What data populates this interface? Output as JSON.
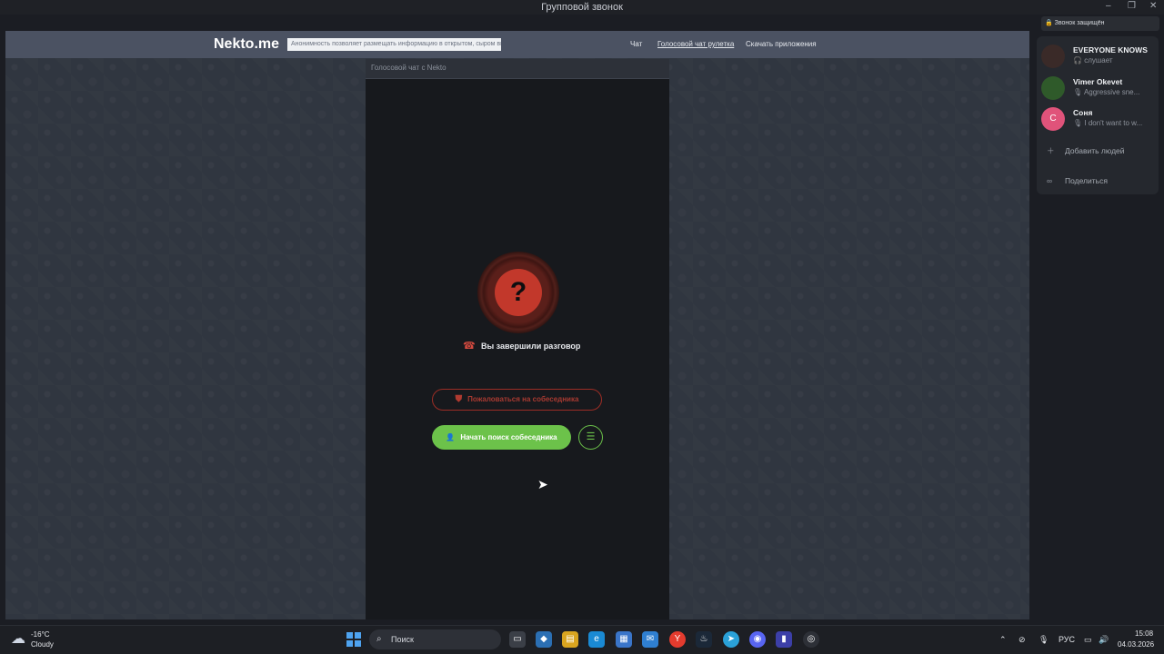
{
  "window": {
    "title": "Групповой звонок"
  },
  "site": {
    "logo": "Nekto.me",
    "notice": "Анонимность позволяет размещать информацию в открытом, сыром виде!",
    "nav": [
      "Чат",
      "Голосовой чат рулетка",
      "Скачать приложения"
    ],
    "panel_title": "Голосовой чат с Nekto",
    "status_text": "Вы завершили разговор",
    "report_button": "Пожаловаться на собеседника",
    "search_button": "Начать поиск собеседника",
    "question_mark": "?"
  },
  "call": {
    "badge": "Звонок защищён",
    "members": [
      {
        "name": "EVERYONE KNOWS",
        "status": "слушает",
        "avatar_color": "#3a2a28"
      },
      {
        "name": "Vimer Okevet",
        "status": "Aggressive sne...",
        "avatar_color": "#2f5a2a"
      },
      {
        "name": "Соня",
        "status": "I don't want to w...",
        "avatar_color": "#e0537a",
        "initial": "С"
      }
    ],
    "add_people": "Добавить людей",
    "share": "Поделиться"
  },
  "taskbar": {
    "weather_temp": "-16°C",
    "weather_desc": "Cloudy",
    "search_placeholder": "Поиск",
    "language": "РУС",
    "time": "15:08",
    "date": "04.03.2026"
  },
  "colors": {
    "accent_green": "#6cc24a",
    "danger_red": "#c2382b",
    "navbar": "#4b5262"
  }
}
